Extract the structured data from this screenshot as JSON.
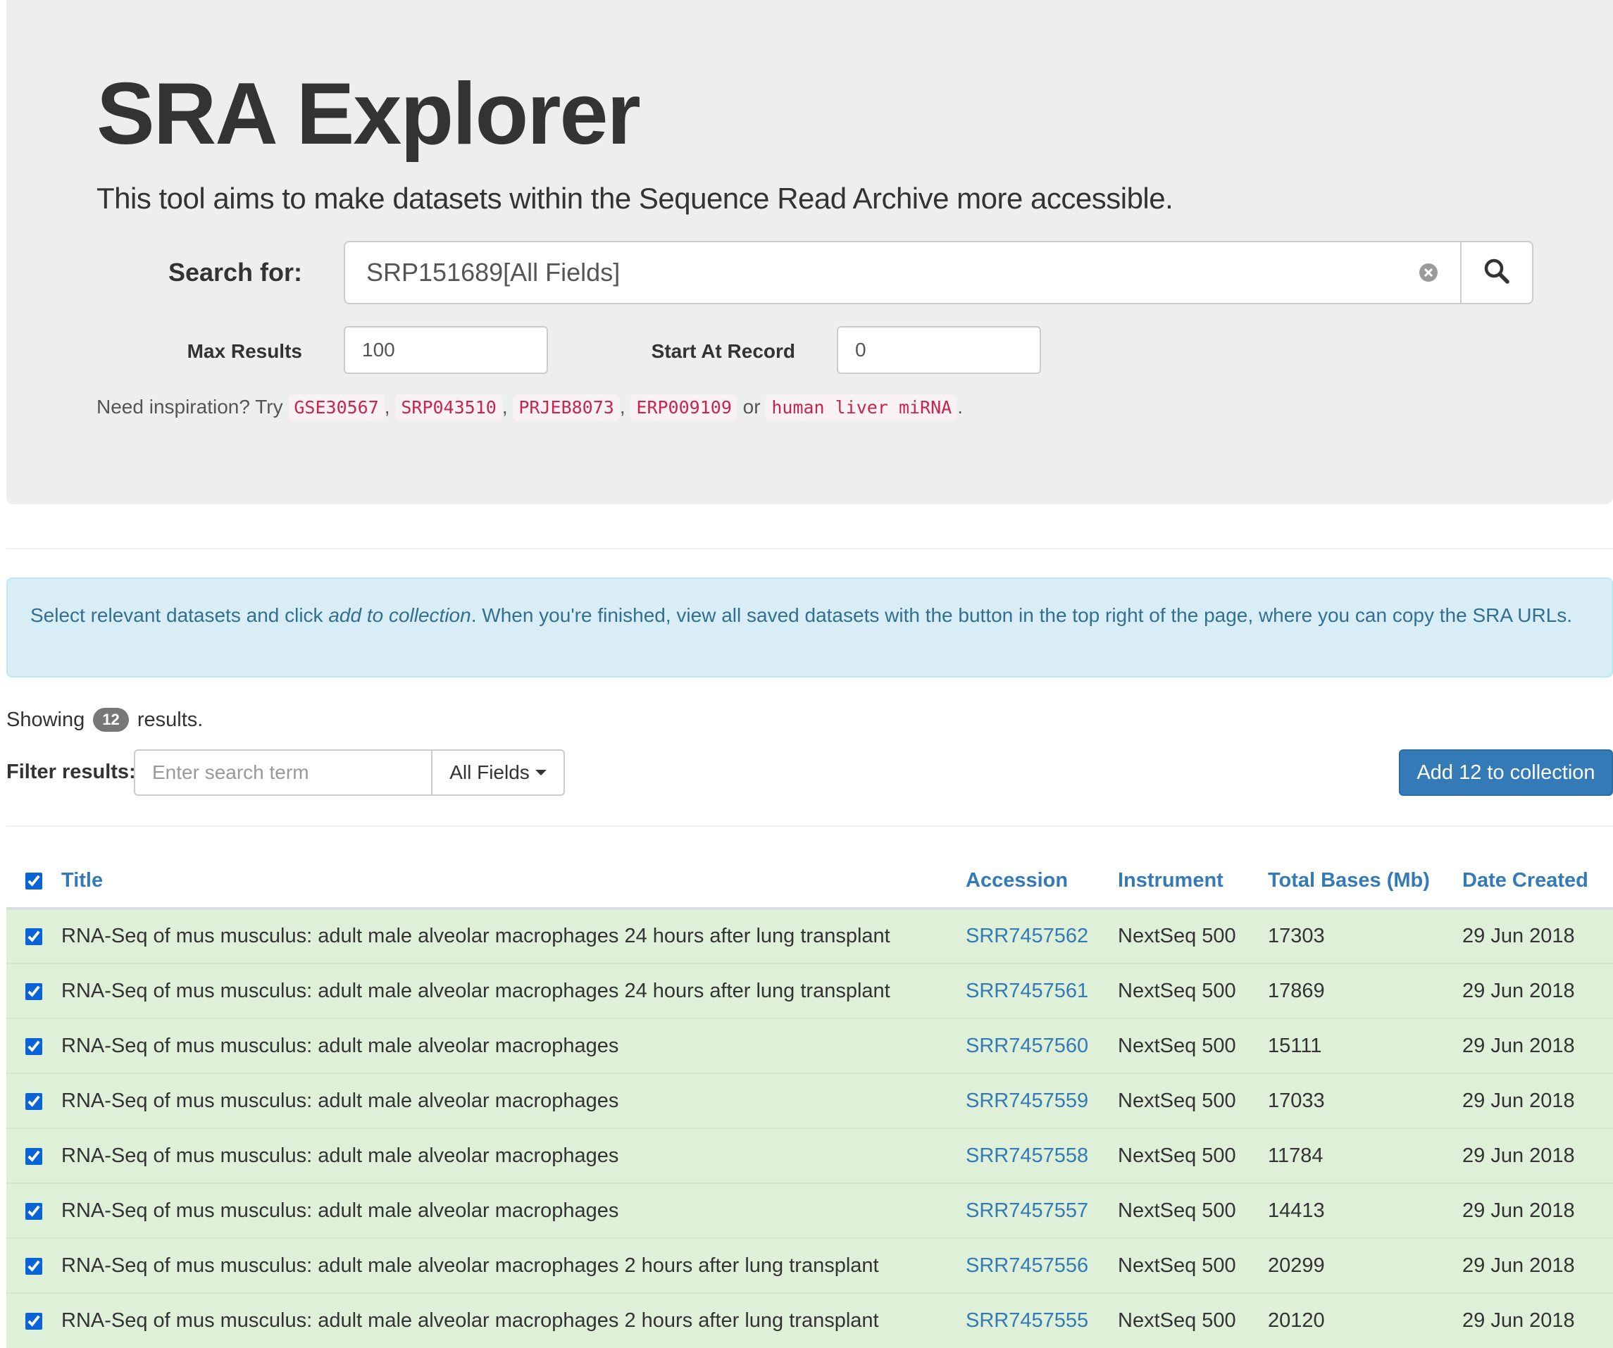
{
  "header": {
    "title": "SRA Explorer",
    "subtitle": "This tool aims to make datasets within the Sequence Read Archive more accessible."
  },
  "search": {
    "label": "Search for:",
    "value": "SRP151689[All Fields]",
    "max_results_label": "Max Results",
    "max_results_value": "100",
    "start_label": "Start At Record",
    "start_value": "0"
  },
  "inspiration": {
    "prefix": "Need inspiration? Try",
    "examples": [
      "GSE30567",
      "SRP043510",
      "PRJEB8073",
      "ERP009109",
      "human liver miRNA"
    ],
    "sep1": ",",
    "sep2": ",",
    "sep3": ",",
    "or": "or",
    "end": "."
  },
  "alert": {
    "part1": "Select relevant datasets and click ",
    "emphasis": "add to collection",
    "part2": ". When you're finished, view all saved datasets with the button in the top right of the page, where you can copy the SRA URLs."
  },
  "results": {
    "showing_prefix": "Showing",
    "count": "12",
    "showing_suffix": "results.",
    "filter_label": "Filter results:",
    "filter_placeholder": "Enter search term",
    "filter_field": "All Fields",
    "add_button": "Add 12 to collection"
  },
  "table": {
    "headers": {
      "title": "Title",
      "accession": "Accession",
      "instrument": "Instrument",
      "bases": "Total Bases (Mb)",
      "date": "Date Created"
    },
    "rows": [
      {
        "title": "RNA-Seq of mus musculus: adult male alveolar macrophages 24 hours after lung transplant",
        "accession": "SRR7457562",
        "instrument": "NextSeq 500",
        "bases": "17303",
        "date": "29 Jun 2018"
      },
      {
        "title": "RNA-Seq of mus musculus: adult male alveolar macrophages 24 hours after lung transplant",
        "accession": "SRR7457561",
        "instrument": "NextSeq 500",
        "bases": "17869",
        "date": "29 Jun 2018"
      },
      {
        "title": "RNA-Seq of mus musculus: adult male alveolar macrophages",
        "accession": "SRR7457560",
        "instrument": "NextSeq 500",
        "bases": "15111",
        "date": "29 Jun 2018"
      },
      {
        "title": "RNA-Seq of mus musculus: adult male alveolar macrophages",
        "accession": "SRR7457559",
        "instrument": "NextSeq 500",
        "bases": "17033",
        "date": "29 Jun 2018"
      },
      {
        "title": "RNA-Seq of mus musculus: adult male alveolar macrophages",
        "accession": "SRR7457558",
        "instrument": "NextSeq 500",
        "bases": "11784",
        "date": "29 Jun 2018"
      },
      {
        "title": "RNA-Seq of mus musculus: adult male alveolar macrophages",
        "accession": "SRR7457557",
        "instrument": "NextSeq 500",
        "bases": "14413",
        "date": "29 Jun 2018"
      },
      {
        "title": "RNA-Seq of mus musculus: adult male alveolar macrophages 2 hours after lung transplant",
        "accession": "SRR7457556",
        "instrument": "NextSeq 500",
        "bases": "20299",
        "date": "29 Jun 2018"
      },
      {
        "title": "RNA-Seq of mus musculus: adult male alveolar macrophages 2 hours after lung transplant",
        "accession": "SRR7457555",
        "instrument": "NextSeq 500",
        "bases": "20120",
        "date": "29 Jun 2018"
      }
    ]
  },
  "icons": {
    "clear": "clear-circle-icon",
    "search": "magnifier-icon",
    "dropdown": "caret-down-icon"
  },
  "colors": {
    "link": "#337ab7",
    "code": "#c7254e",
    "row_selected": "#dff0d8",
    "alert_bg": "#d9edf7",
    "alert_text": "#31708f",
    "button": "#337ab7"
  }
}
